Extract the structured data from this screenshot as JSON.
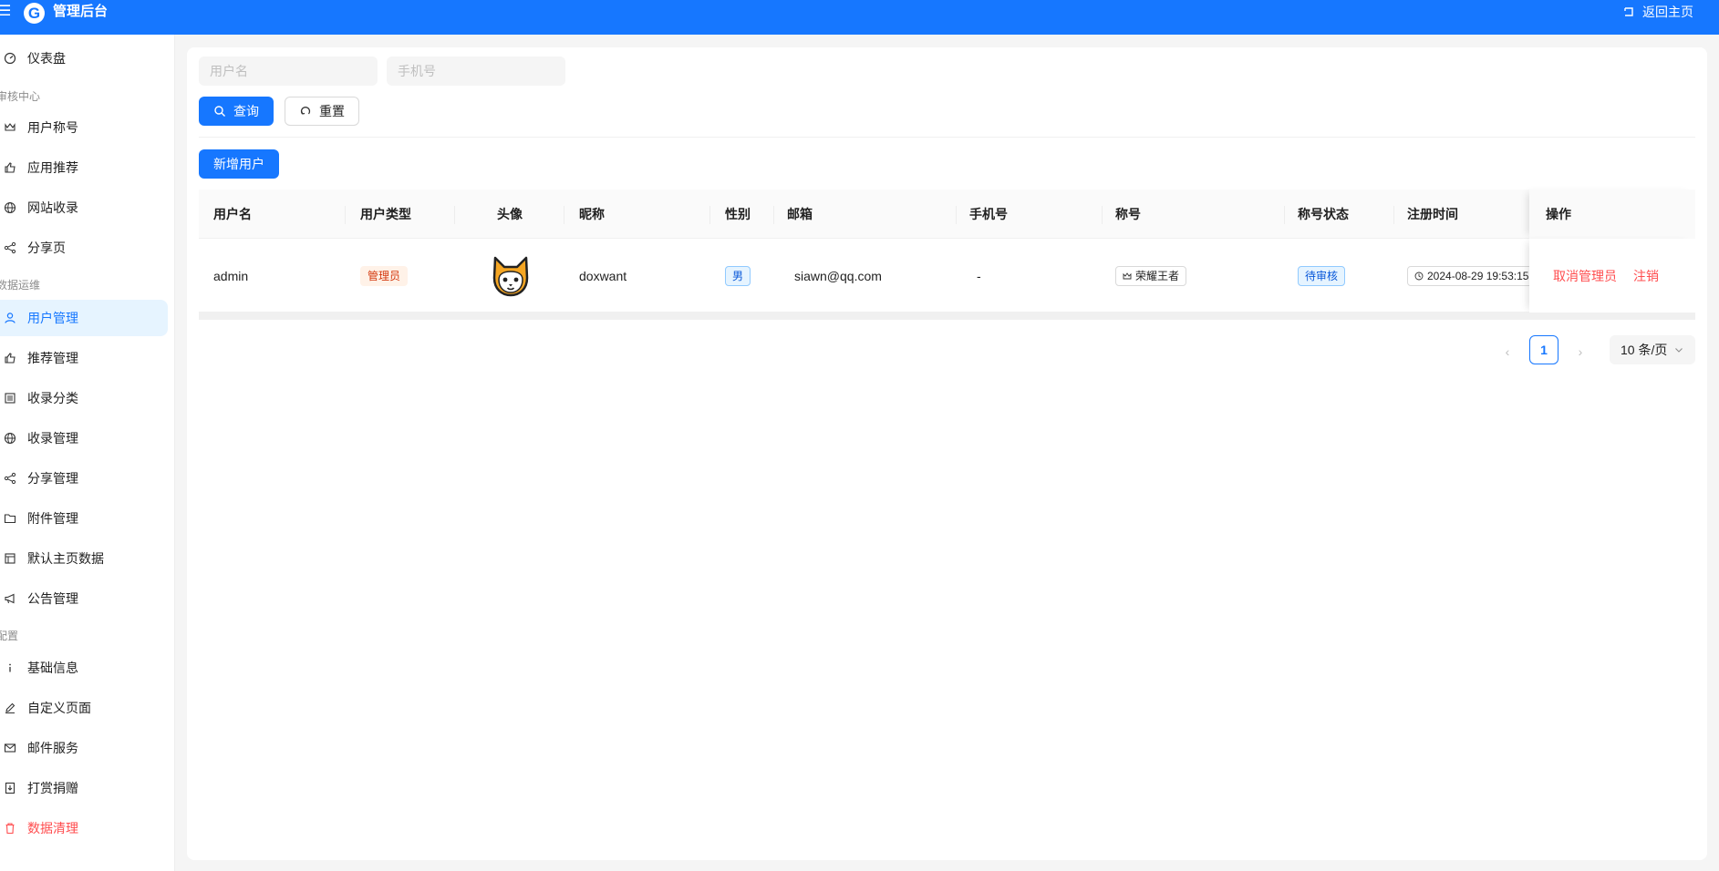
{
  "header": {
    "logo_letter": "G",
    "title": "管理后台",
    "home_label": "返回主页"
  },
  "sidebar": {
    "items": [
      {
        "label": "仪表盘",
        "icon": "dashboard-icon"
      },
      {
        "group": "审核中心"
      },
      {
        "label": "用户称号",
        "icon": "crown-icon"
      },
      {
        "label": "应用推荐",
        "icon": "like-icon"
      },
      {
        "label": "网站收录",
        "icon": "globe-icon"
      },
      {
        "label": "分享页",
        "icon": "share-icon"
      },
      {
        "group": "数据运维"
      },
      {
        "label": "用户管理",
        "icon": "user-icon",
        "active": true
      },
      {
        "label": "推荐管理",
        "icon": "like-icon"
      },
      {
        "label": "收录分类",
        "icon": "list-icon"
      },
      {
        "label": "收录管理",
        "icon": "globe-icon"
      },
      {
        "label": "分享管理",
        "icon": "share-icon"
      },
      {
        "label": "附件管理",
        "icon": "folder-icon"
      },
      {
        "label": "默认主页数据",
        "icon": "layout-icon"
      },
      {
        "label": "公告管理",
        "icon": "megaphone-icon"
      },
      {
        "group": "配置"
      },
      {
        "label": "基础信息",
        "icon": "info-icon"
      },
      {
        "label": "自定义页面",
        "icon": "edit-icon"
      },
      {
        "label": "邮件服务",
        "icon": "mail-icon"
      },
      {
        "label": "打赏捐赠",
        "icon": "download-icon"
      },
      {
        "label": "数据清理",
        "icon": "trash-icon",
        "danger": true
      }
    ]
  },
  "filters": {
    "username_placeholder": "用户名",
    "username_value": "",
    "phone_placeholder": "手机号",
    "phone_value": "",
    "search_label": "查询",
    "reset_label": "重置"
  },
  "actions": {
    "add_user_label": "新增用户"
  },
  "table": {
    "columns": [
      "用户名",
      "用户类型",
      "头像",
      "昵称",
      "性别",
      "邮箱",
      "手机号",
      "称号",
      "称号状态",
      "注册时间",
      "操作"
    ],
    "rows": [
      {
        "username": "admin",
        "user_type": "管理员",
        "nickname": "doxwant",
        "gender": "男",
        "email": "siawn@qq.com",
        "phone": "-",
        "title": "荣耀王者",
        "title_status": "待审核",
        "registered": "2024-08-29 19:53:15",
        "op_cancel_admin": "取消管理员",
        "op_deregister": "注销"
      }
    ]
  },
  "pagination": {
    "prev": "‹",
    "current_page": "1",
    "next": "›",
    "page_size": "10 条/页"
  },
  "colors": {
    "primary": "#1677ff",
    "danger": "#ff4d4f",
    "active_bg": "#e6f4ff"
  }
}
